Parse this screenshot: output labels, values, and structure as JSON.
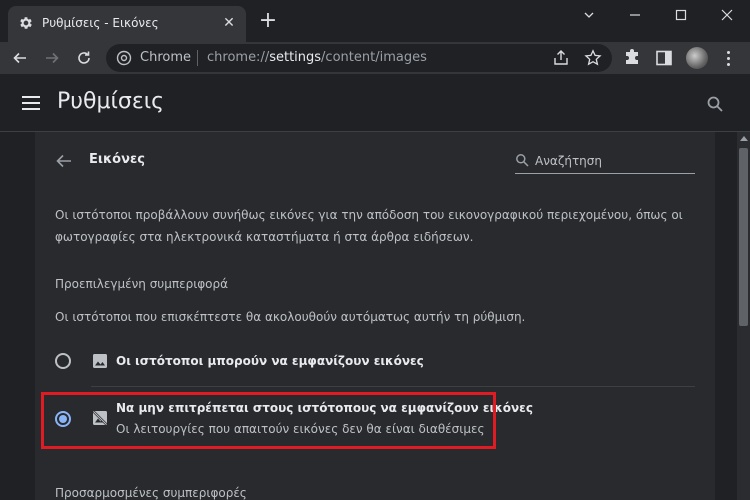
{
  "tab": {
    "title": "Ρυθμίσεις - Εικόνες",
    "icon": "gear-icon"
  },
  "omnibox": {
    "chip": "Chrome",
    "url_prefix": "chrome://",
    "url_host": "settings",
    "url_path": "/content/images"
  },
  "settings": {
    "title": "Ρυθμίσεις"
  },
  "section": {
    "title": "Εικόνες",
    "search_placeholder": "Αναζήτηση",
    "description": "Οι ιστότοποι προβάλλουν συνήθως εικόνες για την απόδοση του εικονογραφικού περιεχομένου, όπως οι φωτογραφίες στα ηλεκτρονικά καταστήματα ή στα άρθρα ειδήσεων.",
    "default_heading": "Προεπιλεγμένη συμπεριφορά",
    "default_desc": "Οι ιστότοποι που επισκέπτεστε θα ακολουθούν αυτόματως αυτήν τη ρύθμιση.",
    "options": [
      {
        "label": "Οι ιστότοποι μπορούν να εμφανίζουν εικόνες",
        "sub": "",
        "checked": false,
        "icon": "image-icon"
      },
      {
        "label": "Να μην επιτρέπεται στους ιστότοπους να εμφανίζουν εικόνες",
        "sub": "Οι λειτουργίες που απαιτούν εικόνες δεν θα είναι διαθέσιμες",
        "checked": true,
        "icon": "image-off-icon"
      }
    ],
    "custom_heading": "Προσαρμοσμένες συμπεριφορές"
  },
  "colors": {
    "accent": "#8ab4f8",
    "highlight": "#e01b24",
    "background": "#202124",
    "card": "#292a2d"
  }
}
